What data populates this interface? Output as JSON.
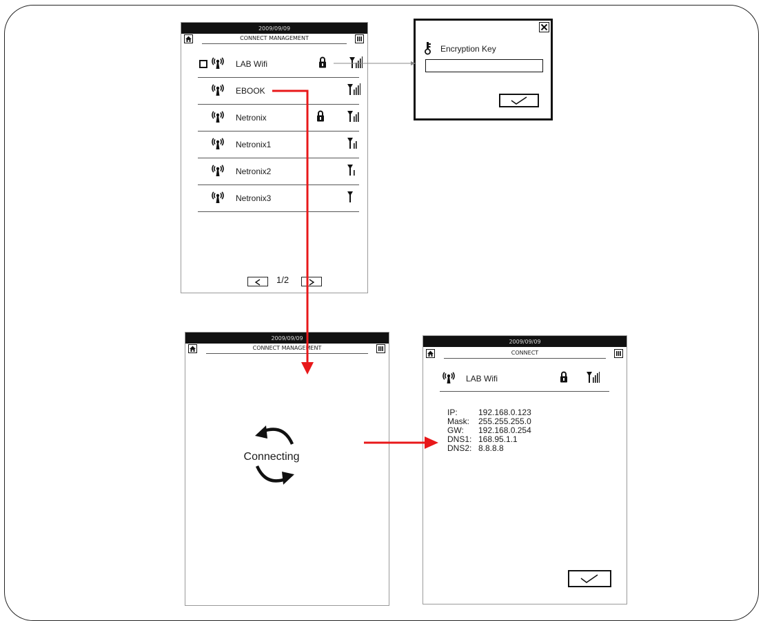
{
  "colors": {
    "accent_arrow": "#e8181a",
    "bar": "#111111"
  },
  "list_screen": {
    "date": "2009/09/09",
    "title": "CONNECT MANAGEMENT",
    "networks": [
      {
        "name": "LAB Wifi",
        "locked": true,
        "signal": 4,
        "checkbox": true
      },
      {
        "name": "EBOOK",
        "locked": false,
        "signal": 4,
        "checkbox": false
      },
      {
        "name": "Netronix",
        "locked": true,
        "signal": 3,
        "checkbox": false
      },
      {
        "name": "Netronix1",
        "locked": false,
        "signal": 2,
        "checkbox": false
      },
      {
        "name": "Netronix2",
        "locked": false,
        "signal": 1,
        "checkbox": false
      },
      {
        "name": "Netronix3",
        "locked": false,
        "signal": 0,
        "checkbox": false
      }
    ],
    "page": "1/2"
  },
  "key_dialog": {
    "label": "Encryption Key",
    "input_value": ""
  },
  "connecting_screen": {
    "date": "2009/09/09",
    "title": "CONNECT MANAGEMENT",
    "status": "Connecting"
  },
  "result_screen": {
    "date": "2009/09/09",
    "title": "CONNECT",
    "network": "LAB Wifi",
    "info": [
      {
        "key": "IP:",
        "value": "192.168.0.123"
      },
      {
        "key": "Mask:",
        "value": "255.255.255.0"
      },
      {
        "key": "GW:",
        "value": "192.168.0.254"
      },
      {
        "key": "DNS1:",
        "value": "168.95.1.1"
      },
      {
        "key": "DNS2:",
        "value": "8.8.8.8"
      }
    ]
  }
}
